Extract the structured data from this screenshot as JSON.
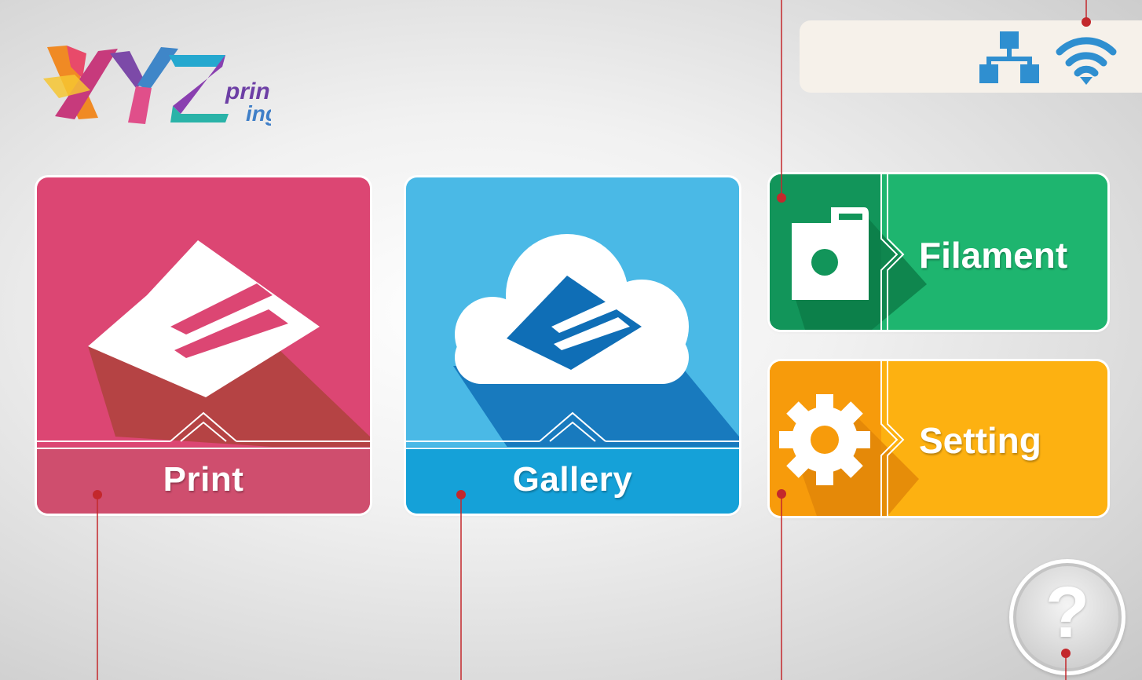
{
  "app": {
    "logo_name": "xyzprinting-logo",
    "background": "#e6e6e6"
  },
  "status_bar": {
    "icons": [
      "network-icon",
      "wifi-icon"
    ],
    "icon_color": "#2f8fd0"
  },
  "tiles": {
    "print": {
      "label": "Print",
      "color": "#dc4673",
      "icon": "print-icon"
    },
    "gallery": {
      "label": "Gallery",
      "color": "#4ab9e6",
      "icon": "cloud-gallery-icon"
    },
    "filament": {
      "label": "Filament",
      "color": "#1eb56f",
      "icon": "filament-cartridge-icon"
    },
    "setting": {
      "label": "Setting",
      "color": "#fdb111",
      "icon": "gear-icon"
    }
  },
  "help": {
    "label": "?",
    "icon": "help-icon"
  },
  "callouts": {
    "color": "#c3282c"
  }
}
